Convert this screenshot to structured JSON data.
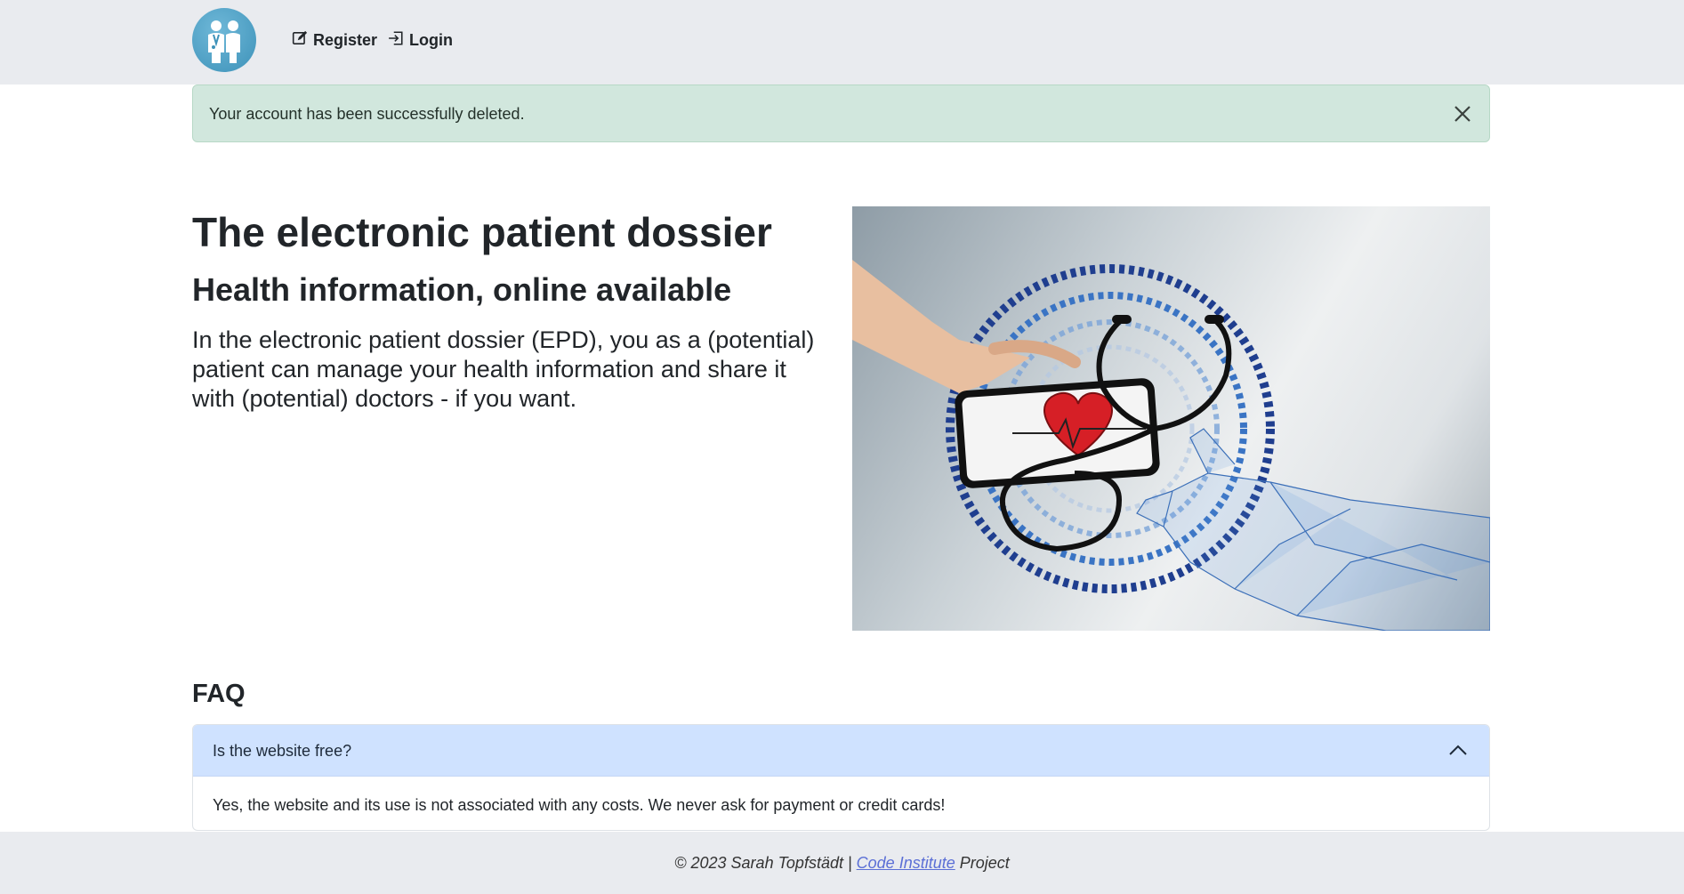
{
  "navbar": {
    "logo_icon": "doctor-patient-logo",
    "register_label": "Register",
    "login_label": "Login"
  },
  "alert": {
    "message": "Your account has been successfully deleted.",
    "status_color": "#d1e7dd"
  },
  "hero": {
    "title": "The electronic patient dossier",
    "subtitle": "Health information, online available",
    "text": "In the electronic patient dossier (EPD), you as a (potential) patient can manage your health information and share it with (potential) doctors - if you want.",
    "image_icon": "hand-phone-stethoscope-heart-image"
  },
  "faq": {
    "heading": "FAQ",
    "items": [
      {
        "question": "Is the website free?",
        "answer": "Yes, the website and its use is not associated with any costs. We never ask for payment or credit cards!",
        "expanded": true
      }
    ],
    "accent_color": "#cfe2ff"
  },
  "footer": {
    "prefix": "© 2023 Sarah Topfstädt | ",
    "link_text": "Code Institute",
    "suffix": " Project",
    "link_color": "#5b6fd6"
  }
}
